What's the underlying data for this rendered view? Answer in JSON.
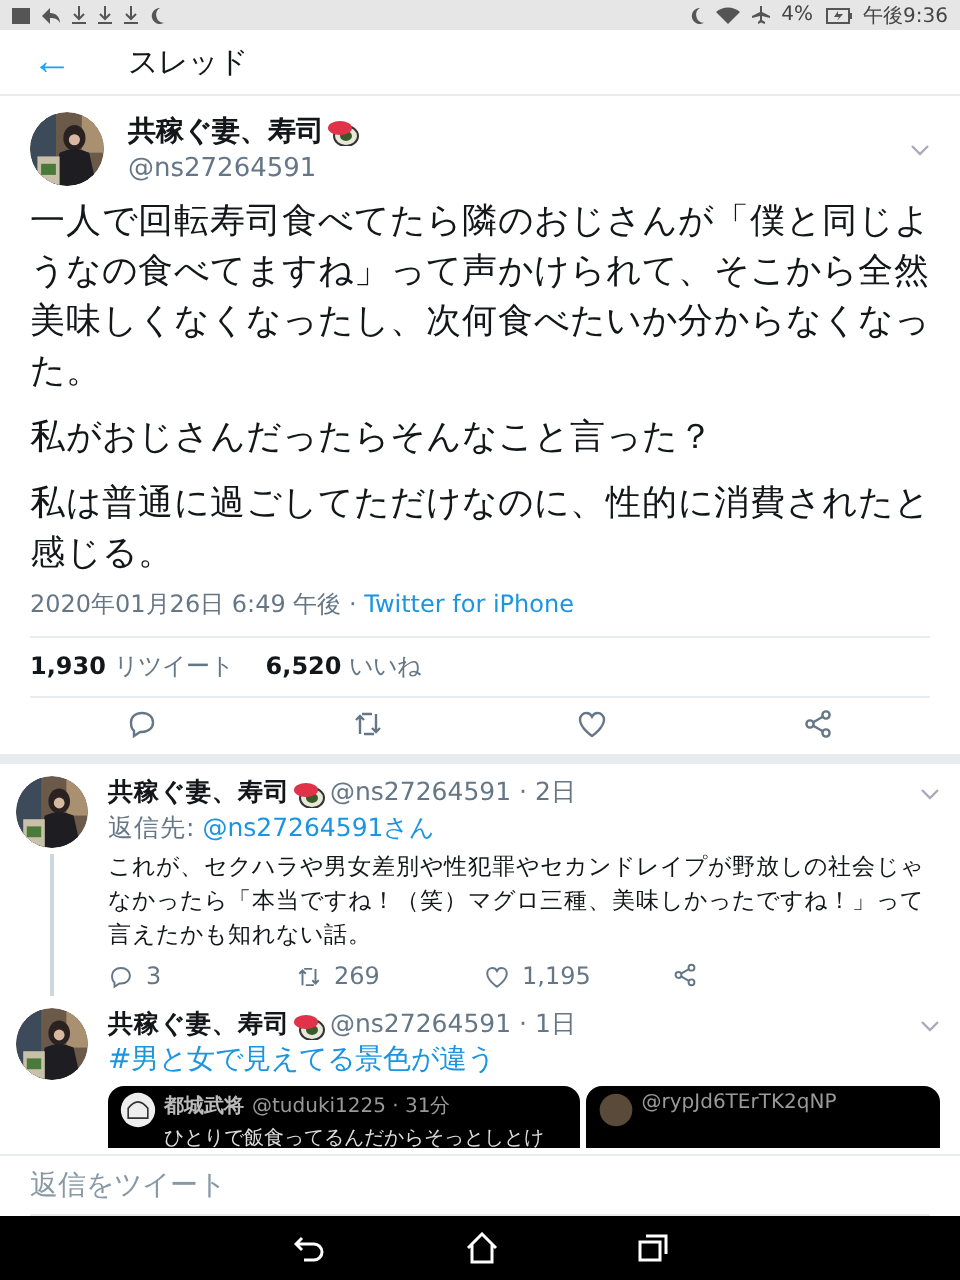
{
  "status_bar": {
    "battery": "4%",
    "time": "午後9:36"
  },
  "header": {
    "back": "←",
    "title": "スレッド"
  },
  "tweet": {
    "name": "共稼ぐ妻、寿司",
    "handle": "@ns27264591",
    "paragraphs": [
      "一人で回転寿司食べてたら隣のおじさんが「僕と同じようなの食べてますね」って声かけられて、そこから全然美味しくなくなったし、次何食べたいか分からなくなった。",
      "私がおじさんだったらそんなこと言った？",
      "私は普通に過ごしてただけなのに、性的に消費されたと感じる。"
    ],
    "timestamp": "2020年01月26日 6:49 午後 · ",
    "source": "Twitter for iPhone",
    "stats": [
      {
        "count": "1,930",
        "label": "リツイート"
      },
      {
        "count": "6,520",
        "label": "いいね"
      }
    ]
  },
  "replies": [
    {
      "name": "共稼ぐ妻、寿司",
      "meta": "@ns27264591 · 2日",
      "reply_to_label": "返信先: ",
      "reply_to": "@ns27264591さん",
      "text": "これが、セクハラや男女差別や性犯罪やセカンドレイプが野放しの社会じゃなかったら「本当ですね！（笑）マグロ三種、美味しかったですね！」って言えたかも知れない話。",
      "replies": "3",
      "retweets": "269",
      "likes": "1,195"
    },
    {
      "name": "共稼ぐ妻、寿司",
      "meta": "@ns27264591 · 1日",
      "hashtag": "#男と女で見えてる景色が違う",
      "media": [
        {
          "name": "都城武将",
          "meta": "@tuduki1225 · 31分",
          "text": "ひとりで飯食ってるんだからそっとしとけ"
        },
        {
          "meta": "@rypJd6TErTK2qNP"
        }
      ]
    }
  ],
  "reply_bar": {
    "placeholder": "返信をツイート"
  }
}
